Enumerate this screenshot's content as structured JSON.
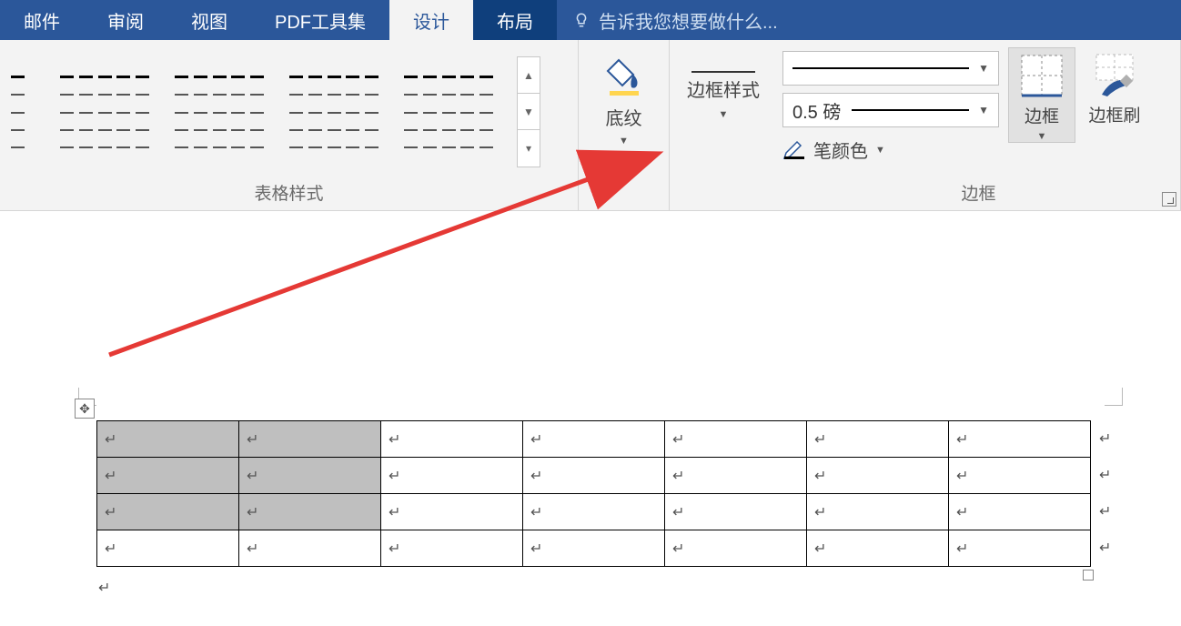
{
  "tabs": {
    "mail": "邮件",
    "review": "审阅",
    "view": "视图",
    "pdf": "PDF工具集",
    "design": "设计",
    "layout": "布局",
    "tellme": "告诉我您想要做什么..."
  },
  "ribbon": {
    "styles_label": "表格样式",
    "shading_label": "底纹",
    "border_style_label": "边框样式",
    "weight_value": "0.5 磅",
    "pen_color_label": "笔颜色",
    "borders_btn": "边框",
    "painter_btn": "边框刷",
    "borders_group_label": "边框"
  },
  "table": {
    "rows": 4,
    "cols": 7,
    "selected_cells": [
      [
        0,
        0
      ],
      [
        0,
        1
      ],
      [
        1,
        0
      ],
      [
        1,
        1
      ],
      [
        2,
        0
      ],
      [
        2,
        1
      ]
    ],
    "paragraph_mark": "↵"
  }
}
